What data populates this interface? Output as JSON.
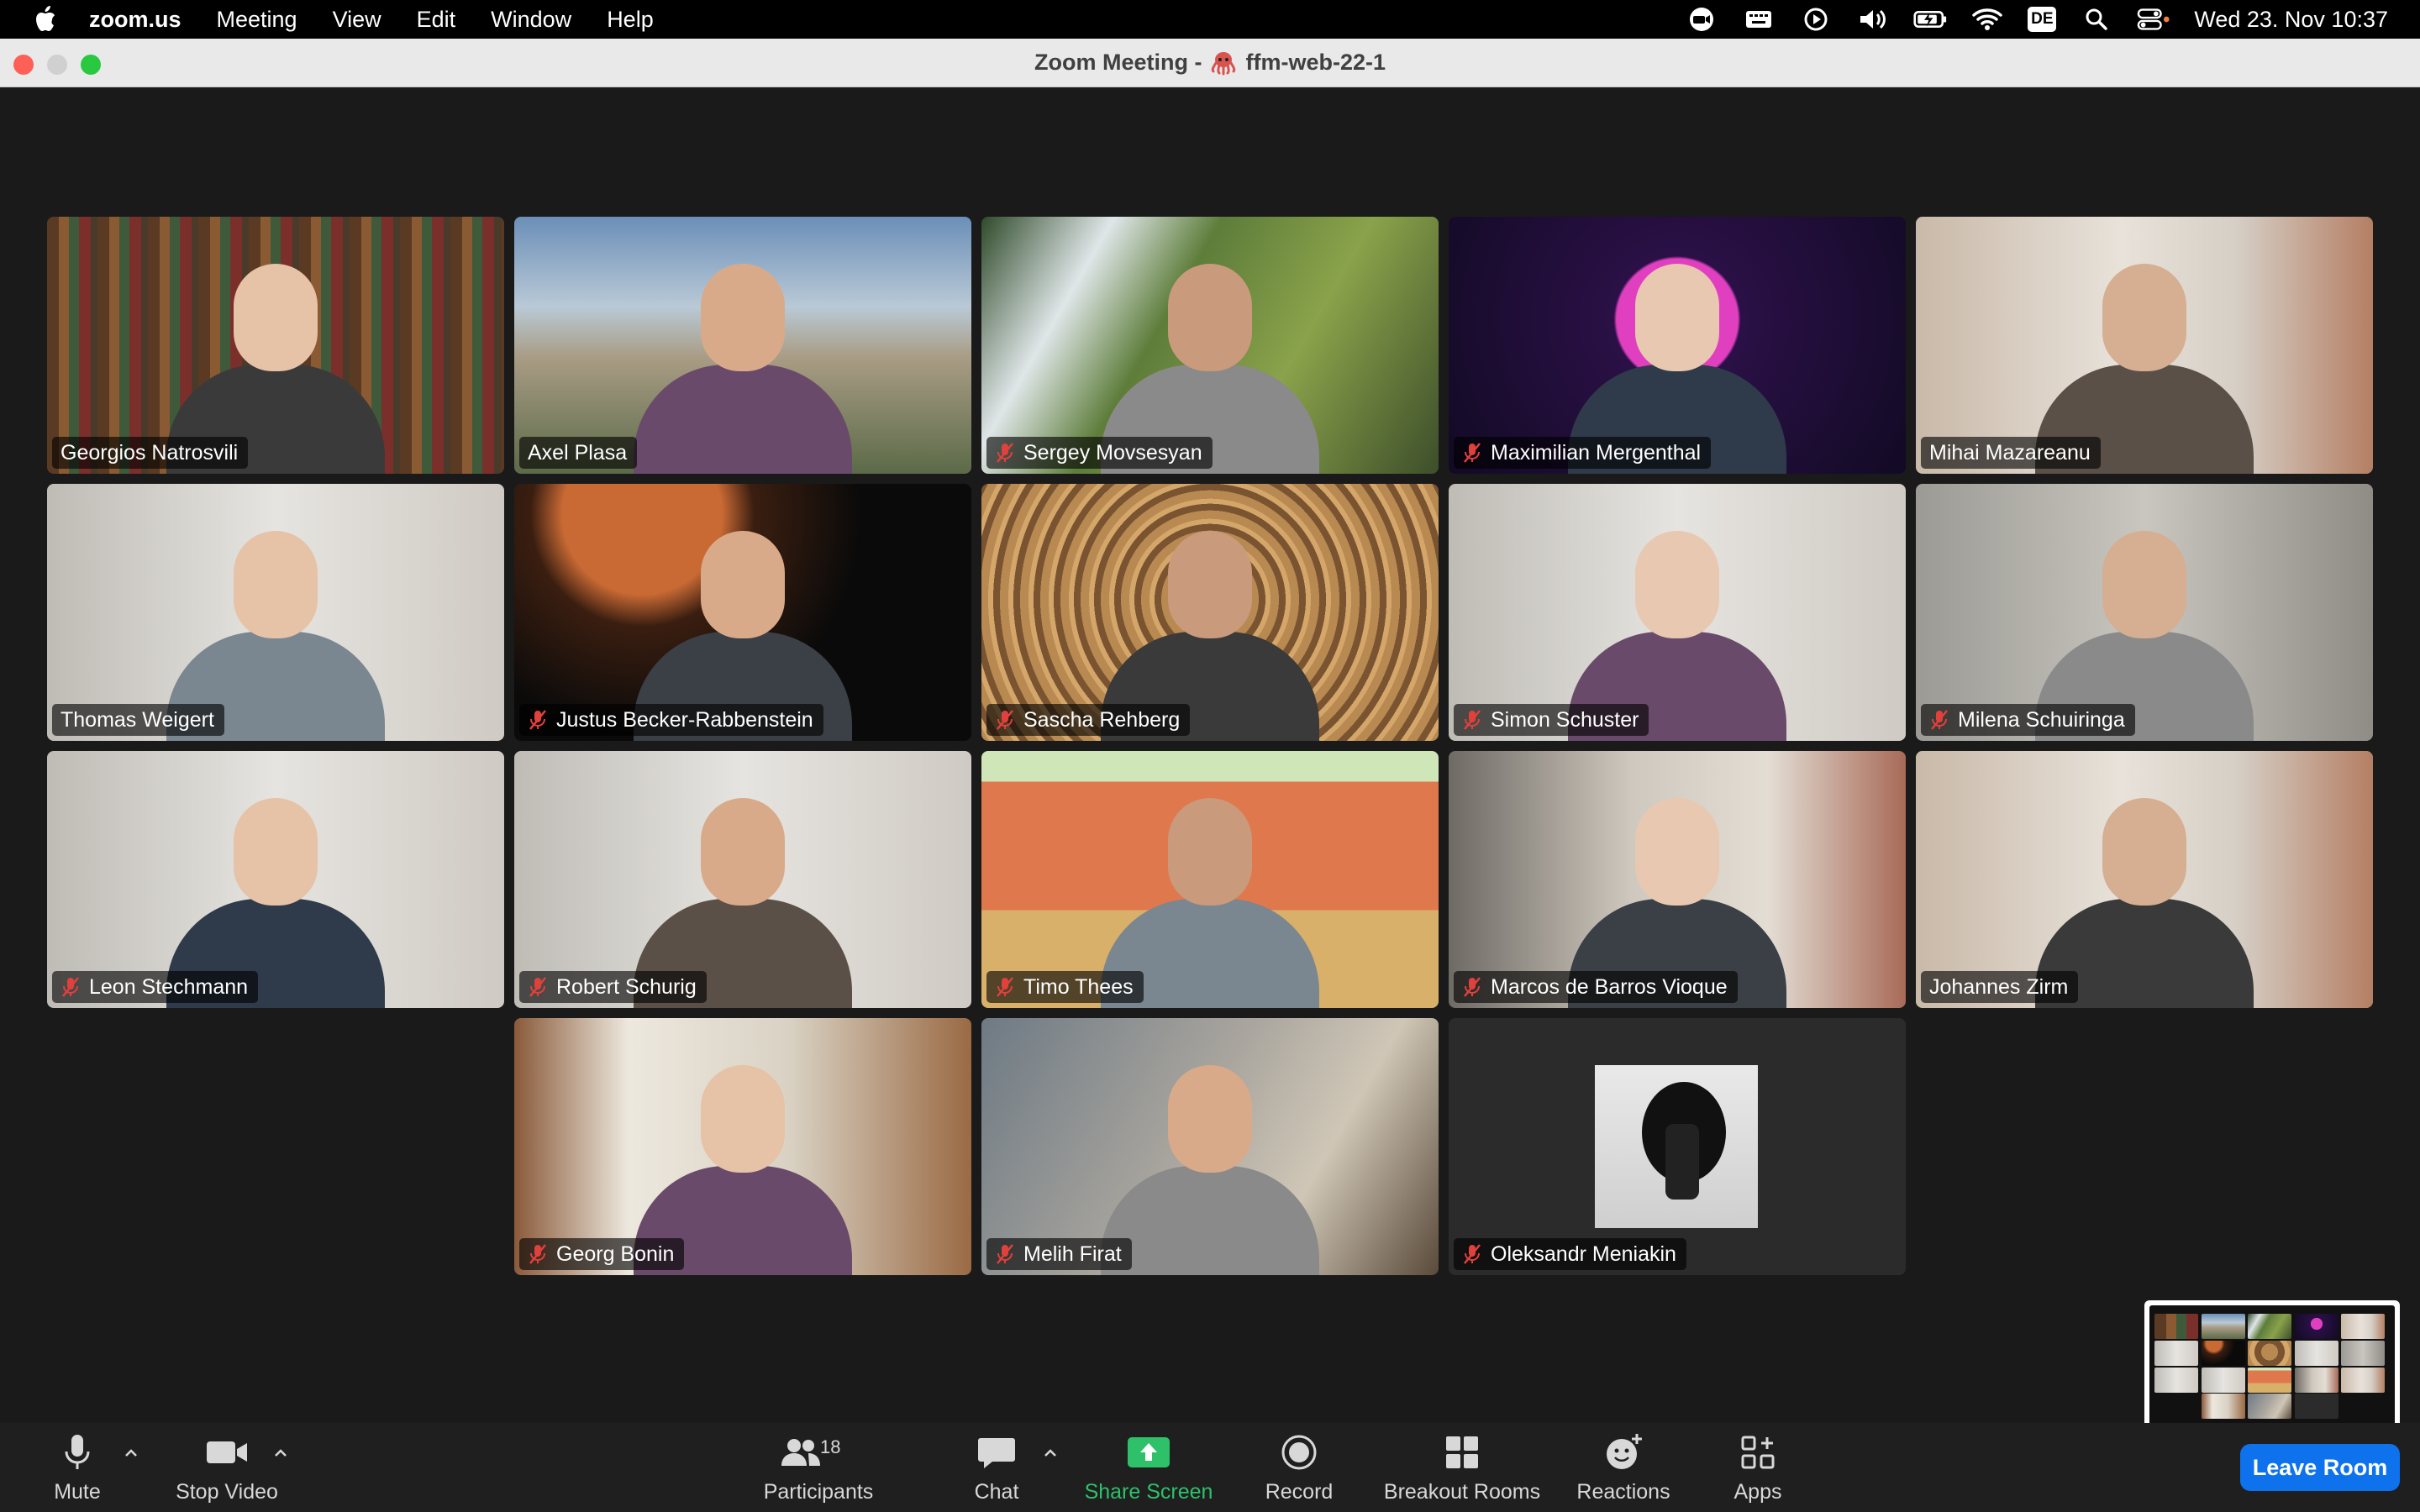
{
  "menubar": {
    "app_name": "zoom.us",
    "menus": [
      "Meeting",
      "View",
      "Edit",
      "Window",
      "Help"
    ],
    "keyboard_layout": "DE",
    "clock": "Wed 23. Nov  10:37"
  },
  "window": {
    "title_prefix": "Zoom Meeting -",
    "title_name": "ffm-web-22-1"
  },
  "participants": [
    {
      "name": "Georgios Natrosvili",
      "muted": false,
      "active": false,
      "bg": "library"
    },
    {
      "name": "Axel Plasa",
      "muted": false,
      "active": false,
      "bg": "city"
    },
    {
      "name": "Sergey Movsesyan",
      "muted": true,
      "active": false,
      "bg": "waterfall"
    },
    {
      "name": "Maximilian Mergenthal",
      "muted": true,
      "active": false,
      "bg": "synthwave"
    },
    {
      "name": "Mihai Mazareanu",
      "muted": false,
      "active": false,
      "bg": "room-light"
    },
    {
      "name": "Thomas Weigert",
      "muted": false,
      "active": false,
      "bg": "room-white"
    },
    {
      "name": "Justus Becker-Rabbenstein",
      "muted": true,
      "active": false,
      "bg": "space"
    },
    {
      "name": "Sascha Rehberg",
      "muted": true,
      "active": false,
      "bg": "carving"
    },
    {
      "name": "Simon Schuster",
      "muted": true,
      "active": false,
      "bg": "room-white"
    },
    {
      "name": "Milena Schuiringa",
      "muted": true,
      "active": false,
      "bg": "room-grey"
    },
    {
      "name": "Leon Stechmann",
      "muted": true,
      "active": false,
      "bg": "room-white"
    },
    {
      "name": "Robert Schurig",
      "muted": true,
      "active": false,
      "bg": "room-white"
    },
    {
      "name": "Timo Thees",
      "muted": true,
      "active": false,
      "bg": "cartoon"
    },
    {
      "name": "Marcos de Barros Vioque",
      "muted": true,
      "active": false,
      "bg": "room-beige"
    },
    {
      "name": "Johannes Zirm",
      "muted": false,
      "active": true,
      "bg": "room-light"
    },
    {
      "name": "Georg Bonin",
      "muted": true,
      "active": false,
      "bg": "japanese"
    },
    {
      "name": "Melih Firat",
      "muted": true,
      "active": false,
      "bg": "blur"
    },
    {
      "name": "Oleksandr Meniakin",
      "muted": true,
      "active": false,
      "bg": "avatar-photo"
    }
  ],
  "toolbar": {
    "mute": "Mute",
    "stop_video": "Stop Video",
    "participants": "Participants",
    "participants_count": "18",
    "chat": "Chat",
    "share_screen": "Share Screen",
    "record": "Record",
    "breakout_rooms": "Breakout Rooms",
    "reactions": "Reactions",
    "apps": "Apps",
    "leave": "Leave Room"
  },
  "colors": {
    "accent_green": "#2ec16a",
    "active_speaker": "#4fd14f",
    "leave_blue": "#0e72ed",
    "muted_red": "#e0413c"
  }
}
